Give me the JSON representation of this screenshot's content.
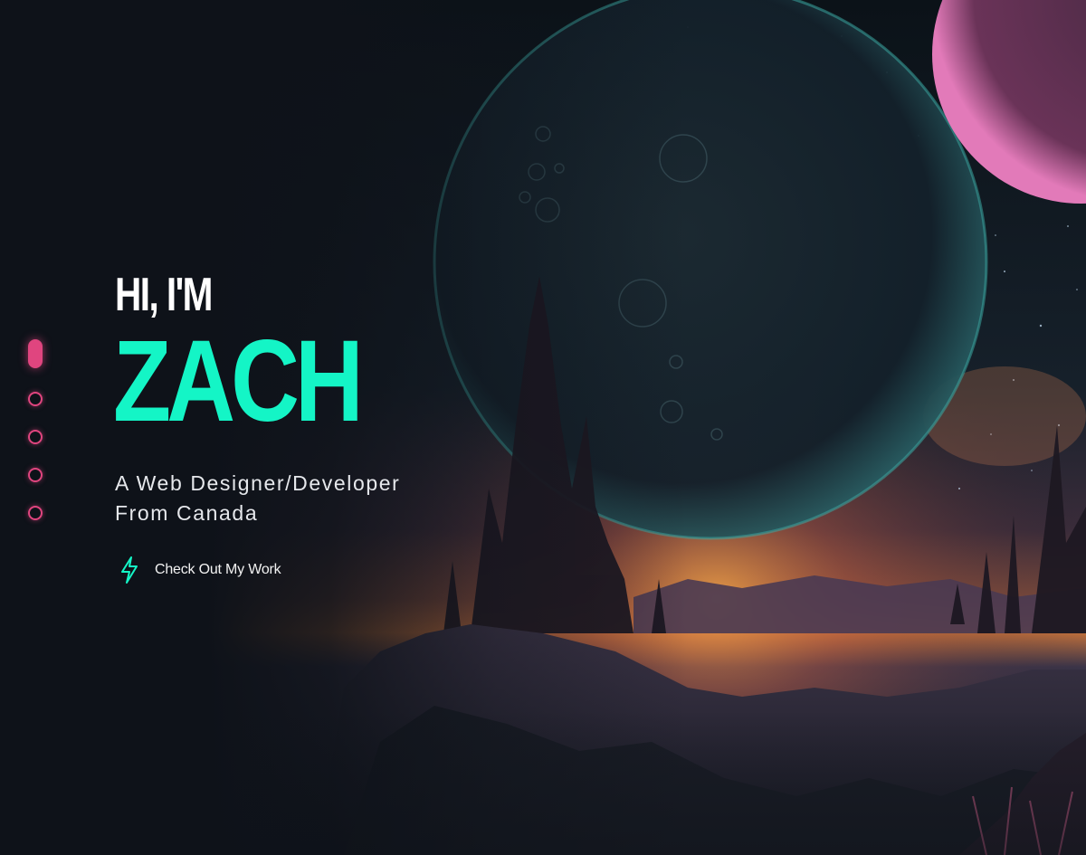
{
  "hero": {
    "greeting": "HI, I'M",
    "name": "ZACH",
    "tagline_line1": "A Web Designer/Developer",
    "tagline_line2": "From Canada",
    "cta_label": "Check Out My Work",
    "cta_icon": "lightning-bolt-icon"
  },
  "section_nav": {
    "items": [
      "section-1",
      "section-2",
      "section-3",
      "section-4",
      "section-5"
    ],
    "active_index": 0
  },
  "colors": {
    "background": "#0e1219",
    "accent_teal": "#14f5c6",
    "accent_pink": "#e0457f",
    "text_primary": "#ffffff"
  },
  "background_image": {
    "subject": "alien-planet-landscape",
    "icon": "planet-landscape-illustration"
  }
}
